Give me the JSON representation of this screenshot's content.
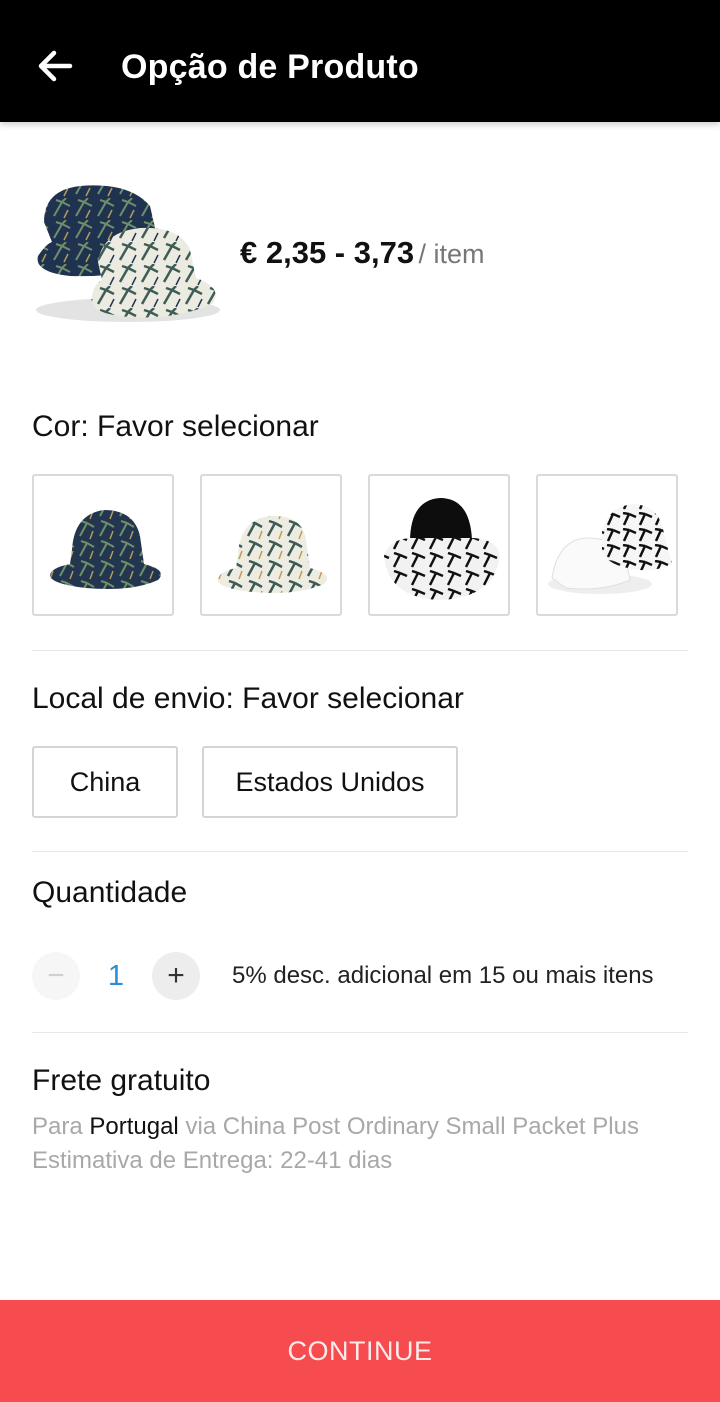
{
  "header": {
    "title": "Opção de Produto",
    "back_icon": "arrow-left-icon"
  },
  "product": {
    "price": "€ 2,35 - 3,73",
    "unit": "/ item"
  },
  "color": {
    "label": "Cor: Favor selecionar",
    "options": [
      "navy-palm-print-hat",
      "cream-palm-print-hat",
      "black-white-palm-hat",
      "white-black-palm-hat"
    ]
  },
  "shipping_origin": {
    "label": "Local de envio: Favor selecionar",
    "options": [
      "China",
      "Estados Unidos"
    ]
  },
  "quantity": {
    "label": "Quantidade",
    "minus": "−",
    "value": "1",
    "plus": "+",
    "discount": "5% desc. adicional em 15 ou mais itens"
  },
  "delivery": {
    "title": "Frete gratuito",
    "to_prefix": "Para",
    "country": "Portugal",
    "via": "via China Post Ordinary Small Packet Plus",
    "estimate": "Estimativa de Entrega: 22-41 dias"
  },
  "footer": {
    "continue_label": "CONTINUE"
  },
  "colors": {
    "header_bg": "#000000",
    "accent_red": "#f64b4f",
    "quantity_blue": "#2a8fd8"
  }
}
